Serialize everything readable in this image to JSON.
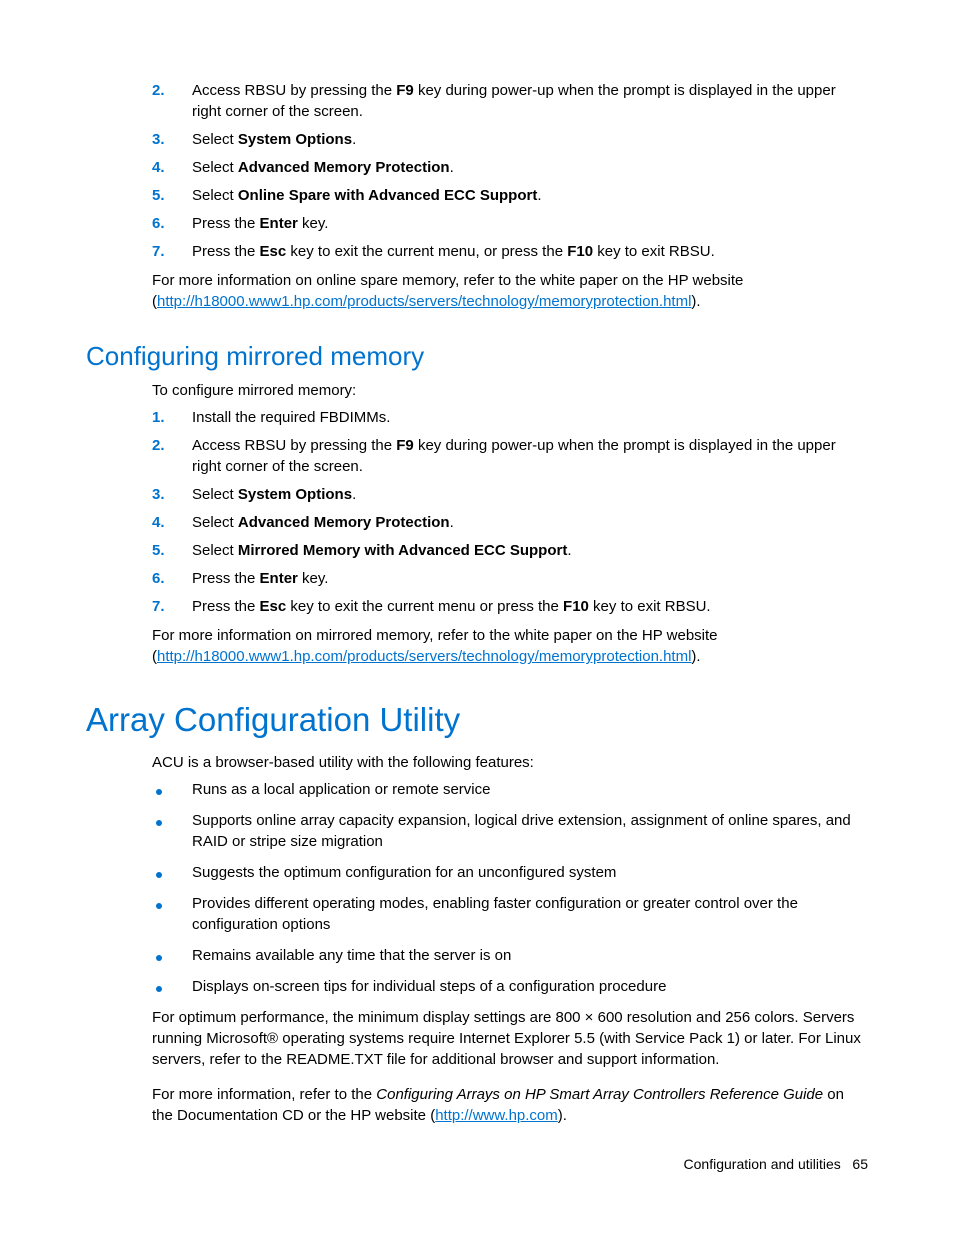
{
  "section1": {
    "steps": [
      {
        "n": "2.",
        "pre": "Access RBSU by pressing the ",
        "b": "F9",
        "post": " key during power-up when the prompt is displayed in the upper right corner of the screen."
      },
      {
        "n": "3.",
        "pre": "Select ",
        "b": "System Options",
        "post": "."
      },
      {
        "n": "4.",
        "pre": "Select ",
        "b": "Advanced Memory Protection",
        "post": "."
      },
      {
        "n": "5.",
        "pre": "Select ",
        "b": "Online Spare with Advanced ECC Support",
        "post": "."
      },
      {
        "n": "6.",
        "pre": "Press the ",
        "b": "Enter",
        "post": " key."
      },
      {
        "n": "7.",
        "pre": "Press the ",
        "b": "Esc",
        "post": " key to exit the current menu, or press the ",
        "b2": "F10",
        "post2": " key to exit RBSU."
      }
    ],
    "note_pre": "For more information on online spare memory, refer to the white paper on the HP website (",
    "note_link": "http://h18000.www1.hp.com/products/servers/technology/memoryprotection.html",
    "note_post": ")."
  },
  "section2": {
    "title": "Configuring mirrored memory",
    "intro": "To configure mirrored memory:",
    "steps": [
      {
        "n": "1.",
        "pre": "Install the required FBDIMMs.",
        "b": "",
        "post": ""
      },
      {
        "n": "2.",
        "pre": "Access RBSU by pressing the ",
        "b": "F9",
        "post": " key during power-up when the prompt is displayed in the upper right corner of the screen."
      },
      {
        "n": "3.",
        "pre": "Select ",
        "b": "System Options",
        "post": "."
      },
      {
        "n": "4.",
        "pre": "Select ",
        "b": "Advanced Memory Protection",
        "post": "."
      },
      {
        "n": "5.",
        "pre": "Select ",
        "b": "Mirrored Memory with Advanced ECC Support",
        "post": "."
      },
      {
        "n": "6.",
        "pre": "Press the ",
        "b": "Enter",
        "post": " key."
      },
      {
        "n": "7.",
        "pre": "Press the ",
        "b": "Esc",
        "post": " key to exit the current menu or press the ",
        "b2": "F10",
        "post2": " key to exit RBSU."
      }
    ],
    "note_pre": "For more information on mirrored memory, refer to the white paper on the HP website (",
    "note_link": "http://h18000.www1.hp.com/products/servers/technology/memoryprotection.html",
    "note_post": ")."
  },
  "section3": {
    "title": "Array Configuration Utility",
    "intro": "ACU is a browser-based utility with the following features:",
    "bullets": [
      "Runs as a local application or remote service",
      "Supports online array capacity expansion, logical drive extension, assignment of online spares, and RAID or stripe size migration",
      "Suggests the optimum configuration for an unconfigured system",
      "Provides different operating modes, enabling faster configuration or greater control over the configuration options",
      "Remains available any time that the server is on",
      "Displays on-screen tips for individual steps of a configuration procedure"
    ],
    "para1": "For optimum performance, the minimum display settings are 800 × 600 resolution and 256 colors. Servers running Microsoft® operating systems require Internet Explorer 5.5 (with Service Pack 1) or later. For Linux servers, refer to the README.TXT file for additional browser and support information.",
    "para2_pre": "For more information, refer to the ",
    "para2_em": "Configuring Arrays on HP Smart Array Controllers Reference Guide",
    "para2_mid": " on the Documentation CD or the HP website (",
    "para2_link": "http://www.hp.com",
    "para2_post": ")."
  },
  "footer": {
    "label": "Configuration and utilities",
    "page": "65"
  }
}
